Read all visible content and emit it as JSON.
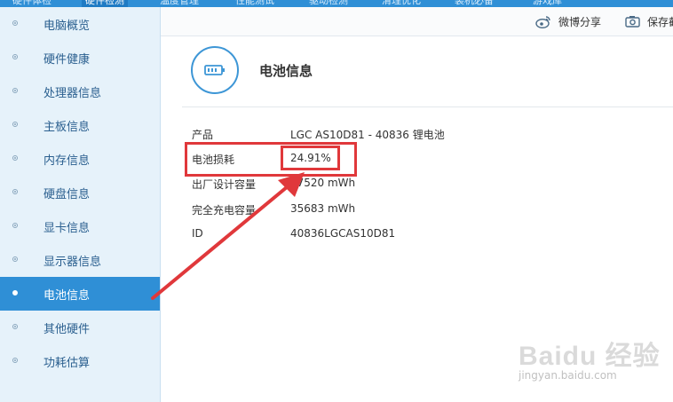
{
  "top_nav": {
    "tabs": [
      "硬件体检",
      "硬件检测",
      "温度管理",
      "性能测试",
      "驱动检测",
      "清理优化",
      "装机必备",
      "游戏库"
    ],
    "active_index": 1
  },
  "sidebar": {
    "items": [
      {
        "label": "电脑概览"
      },
      {
        "label": "硬件健康"
      },
      {
        "label": "处理器信息"
      },
      {
        "label": "主板信息"
      },
      {
        "label": "内存信息"
      },
      {
        "label": "硬盘信息"
      },
      {
        "label": "显卡信息"
      },
      {
        "label": "显示器信息"
      },
      {
        "label": "电池信息",
        "active": true
      },
      {
        "label": "其他硬件"
      },
      {
        "label": "功耗估算"
      }
    ]
  },
  "toolbar": {
    "weibo_share": "微博分享",
    "save": "保存截"
  },
  "header": {
    "title": "电池信息",
    "icon": "battery-icon"
  },
  "info": {
    "rows": [
      {
        "key": "产品",
        "value": "LGC AS10D81 - 40836 锂电池"
      },
      {
        "key": "电池损耗",
        "value": "24.91%"
      },
      {
        "key": "出厂设计容量",
        "value": "47520 mWh"
      },
      {
        "key": "完全充电容量",
        "value": "35683 mWh"
      },
      {
        "key": "ID",
        "value": "40836LGCAS10D81"
      }
    ]
  },
  "watermark": {
    "brand": "Baidu 经验",
    "url": "jingyan.baidu.com"
  },
  "colors": {
    "accent": "#2f8fd6",
    "sidebar_bg": "#e6f2fa",
    "annotation": "#e0383b"
  }
}
